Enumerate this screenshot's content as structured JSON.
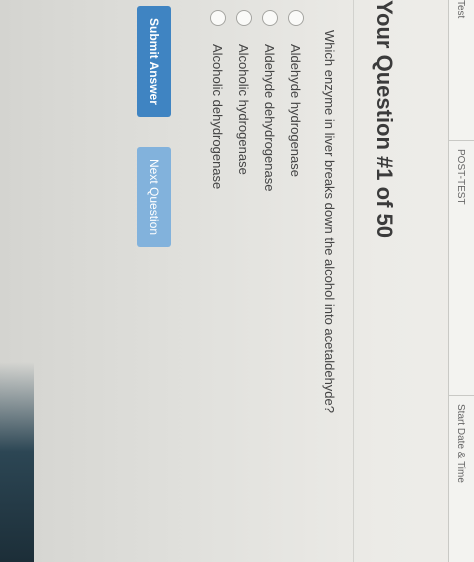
{
  "header": {
    "cols": [
      "Test",
      "POST-TEST",
      "Start Date & Time"
    ]
  },
  "question": {
    "title": "Your Question #1 of 50",
    "text": "Which enzyme in liver breaks down the alcohol into acetaldehyde?"
  },
  "options": [
    "Aldehyde hydrogenase",
    "Aldehyde dehydrogenase",
    "Alcoholic hydrogenase",
    "Alcoholic dehydrogenase"
  ],
  "buttons": {
    "submit": "Submit Answer",
    "next": "Next Question"
  },
  "colors": {
    "submit": "#3f84c2",
    "next": "#82b2dc"
  }
}
